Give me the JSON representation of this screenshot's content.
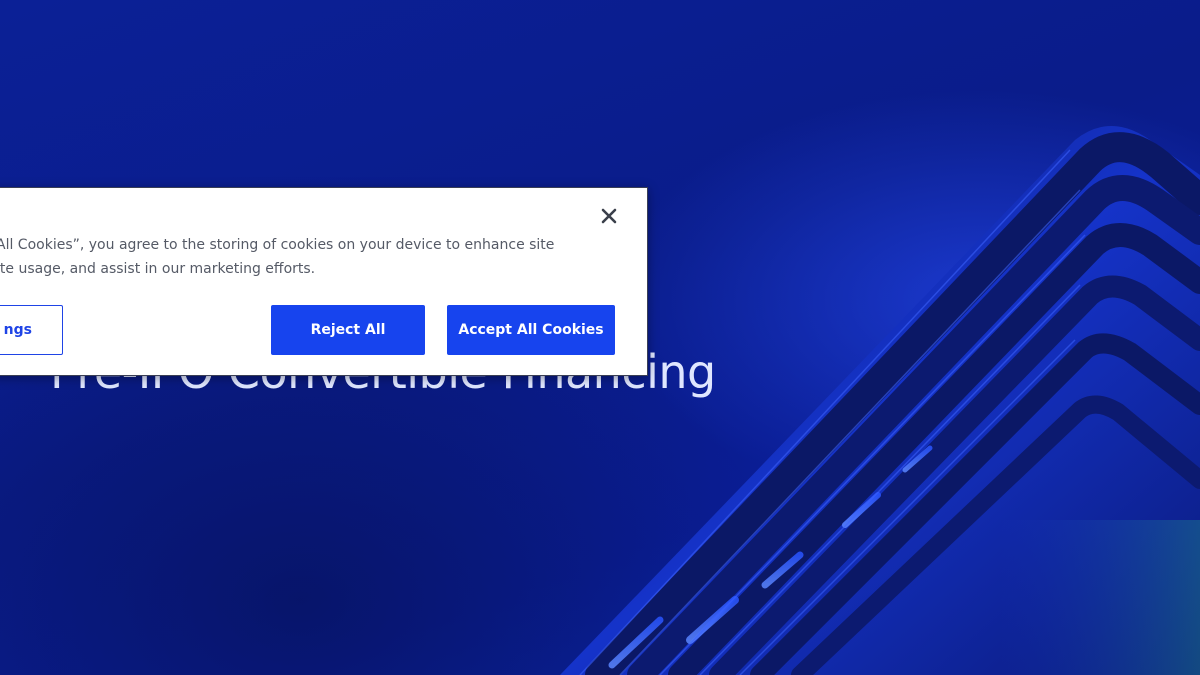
{
  "hero": {
    "title": "Pre-IPO Convertible Financing",
    "colors": {
      "background": "#0a1f8f",
      "title": "#dfe6ff"
    }
  },
  "cookie_banner": {
    "text": "All Cookies”, you agree to the storing of cookies on your device to enhance site\nite usage, and assist in our marketing efforts.",
    "settings_label": "ngs",
    "reject_label": "Reject All",
    "accept_label": "Accept All Cookies",
    "close_icon": "close-icon",
    "colors": {
      "primary": "#1744ee",
      "text": "#555a66",
      "close": "#3a3f4a"
    }
  }
}
